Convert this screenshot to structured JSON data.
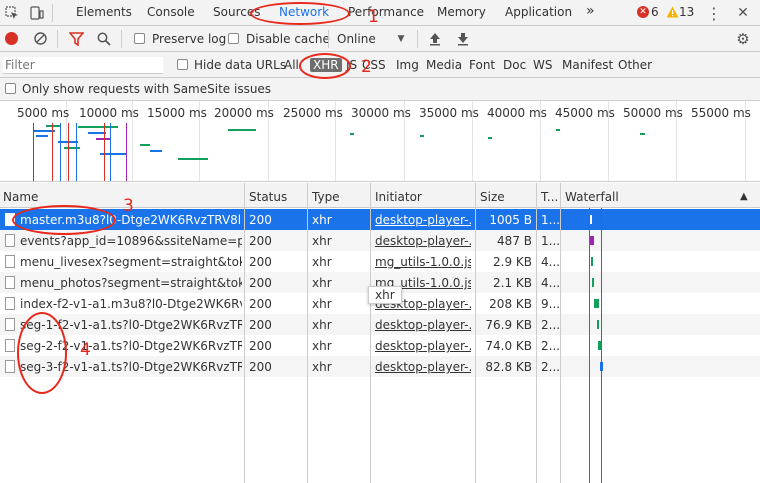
{
  "tabs": [
    "Elements",
    "Console",
    "Sources",
    "Network",
    "Performance",
    "Memory",
    "Application"
  ],
  "more_tabs": "»",
  "errors_count": "6",
  "warnings_count": "13",
  "toolbar": {
    "preserve_log": "Preserve log",
    "disable_cache": "Disable cache",
    "throttle": "Online"
  },
  "filter": {
    "placeholder": "Filter",
    "hide_data_urls": "Hide data URLs",
    "types": [
      "All",
      "XHR",
      "JS",
      "CSS",
      "Img",
      "Media",
      "Font",
      "Doc",
      "WS",
      "Manifest",
      "Other"
    ],
    "active_type": "XHR",
    "samesite": "Only show requests with SameSite issues"
  },
  "timeline_ticks": [
    "5000 ms",
    "10000 ms",
    "15000 ms",
    "20000 ms",
    "25000 ms",
    "30000 ms",
    "35000 ms",
    "40000 ms",
    "45000 ms",
    "50000 ms",
    "55000 ms"
  ],
  "columns": [
    "Name",
    "Status",
    "Type",
    "Initiator",
    "Size",
    "T...",
    "Waterfall"
  ],
  "sort_indicator": "▲",
  "rows": [
    {
      "name": "master.m3u8?l0-Dtge2WK6RvzTRV8lud...",
      "status": "200",
      "type": "xhr",
      "initiator": "desktop-player-...",
      "size": "1005 B",
      "time": "1..."
    },
    {
      "name": "events?app_id=10896&ssiteName=por...",
      "status": "200",
      "type": "xhr",
      "initiator": "desktop-player-...",
      "size": "487 B",
      "time": "1..."
    },
    {
      "name": "menu_livesex?segment=straight&token...",
      "status": "200",
      "type": "xhr",
      "initiator": "mg_utils-1.0.0.js...",
      "size": "2.9 KB",
      "time": "4..."
    },
    {
      "name": "menu_photos?segment=straight&toke...",
      "status": "200",
      "type": "xhr",
      "initiator": "mg_utils-1.0.0.js...",
      "size": "2.1 KB",
      "time": "4..."
    },
    {
      "name": "index-f2-v1-a1.m3u8?l0-Dtge2WK6Rvz...",
      "status": "200",
      "type": "xhr",
      "initiator": "desktop-player-...",
      "size": "208 KB",
      "time": "9..."
    },
    {
      "name": "seg-1-f2-v1-a1.ts?l0-Dtge2WK6RvzTRV...",
      "status": "200",
      "type": "xhr",
      "initiator": "desktop-player-...",
      "size": "76.9 KB",
      "time": "2..."
    },
    {
      "name": "seg-2-f2-v1-a1.ts?l0-Dtge2WK6RvzTRV...",
      "status": "200",
      "type": "xhr",
      "initiator": "desktop-player-...",
      "size": "74.0 KB",
      "time": "2..."
    },
    {
      "name": "seg-3-f2-v1-a1.ts?l0-Dtge2WK6RvzTRV...",
      "status": "200",
      "type": "xhr",
      "initiator": "desktop-player-...",
      "size": "82.8 KB",
      "time": "2..."
    }
  ],
  "tooltip": "xhr",
  "annotations": [
    "1",
    "2",
    "3",
    "4"
  ],
  "colors": {
    "accent": "#1a73e8",
    "annotation": "#e8281b",
    "record": "#d93025"
  }
}
